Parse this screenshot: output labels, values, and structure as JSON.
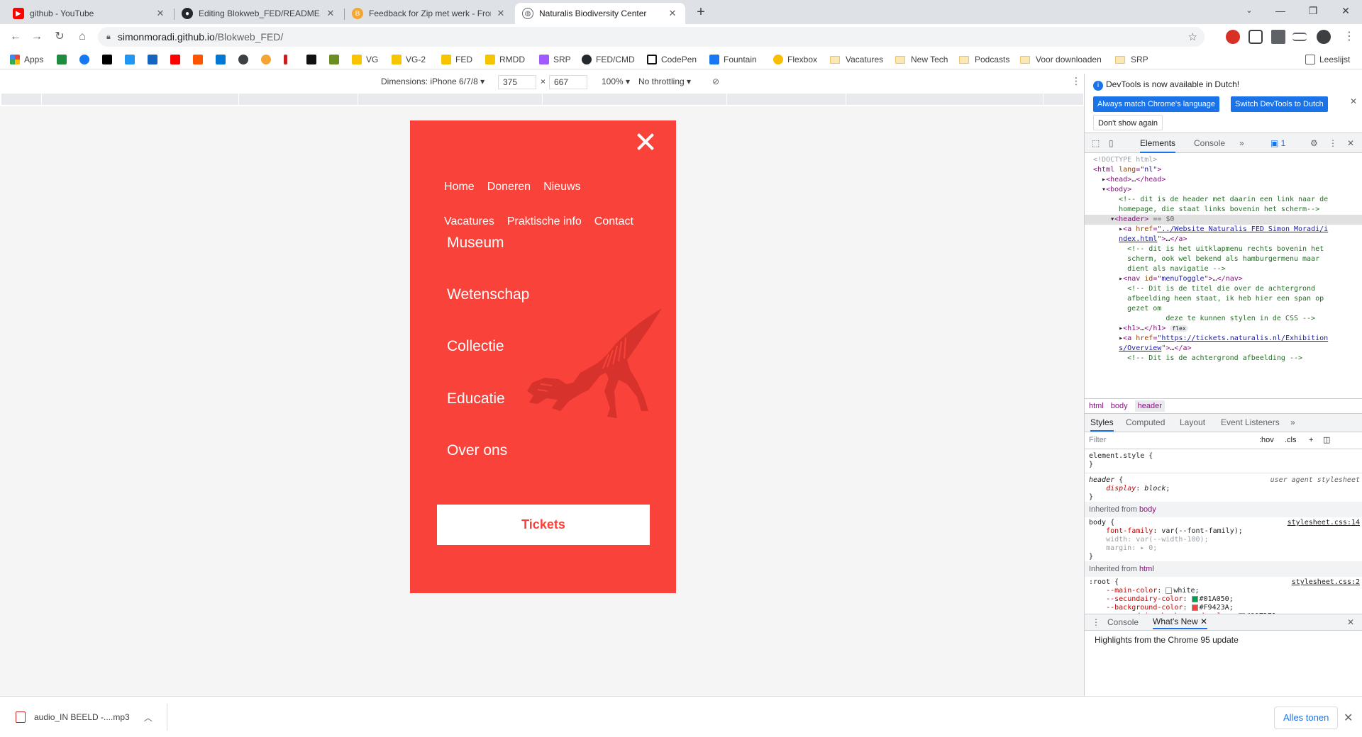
{
  "tabs": [
    {
      "title": "github - YouTube",
      "icon": "youtube-icon",
      "color": "#ff0000"
    },
    {
      "title": "Editing Blokweb_FED/README.m",
      "icon": "github-icon",
      "color": "#24292e"
    },
    {
      "title": "Feedback for Zip met werk - Fror",
      "icon": "feedback-icon",
      "color": "#f4a533"
    },
    {
      "title": "Naturalis Biodiversity Center",
      "icon": "globe-icon",
      "color": "#5f6368"
    }
  ],
  "omnibox": {
    "host": "simonmoradi.github.io",
    "path": "/Blokweb_FED/"
  },
  "bookmarks": {
    "apps": "Apps",
    "items": [
      "VG",
      "VG-2",
      "FED",
      "RMDD",
      "SRP",
      "FED/CMD",
      "CodePen",
      "Fountain",
      "Flexbox"
    ],
    "folders": [
      "Vacatures",
      "New Tech",
      "Podcasts",
      "Voor downloaden",
      "SRP"
    ],
    "reading_list": "Leeslijst"
  },
  "device_toolbar": {
    "dimensions": "Dimensions: iPhone 6/7/8 ▾",
    "width": "375",
    "height": "667",
    "times": "×",
    "zoom": "100% ▾",
    "throttling": "No throttling ▾"
  },
  "page": {
    "subnav_row1": [
      "Home",
      "Doneren",
      "Nieuws"
    ],
    "subnav_row2": [
      "Vacatures",
      "Praktische info",
      "Contact"
    ],
    "mainnav": [
      "Museum",
      "Wetenschap",
      "Collectie",
      "Educatie",
      "Over ons"
    ],
    "tickets": "Tickets",
    "bg_color": "#f9423a"
  },
  "devtools": {
    "info_msg": "DevTools is now available in Dutch!",
    "btn_match": "Always match Chrome's language",
    "btn_switch": "Switch DevTools to Dutch",
    "btn_dont": "Don't show again",
    "tab_elements": "Elements",
    "tab_console": "Console",
    "issues_count": "1",
    "crumbs": [
      "html",
      "body",
      "header"
    ],
    "subtabs": [
      "Styles",
      "Computed",
      "Layout",
      "Event Listeners"
    ],
    "filter_placeholder": "Filter",
    "filter_hov": ":hov",
    "filter_cls": ".cls",
    "inherited_body": "Inherited from",
    "inherited_body_tag": "body",
    "inherited_html": "Inherited from",
    "inherited_html_tag": "html",
    "drawer_console": "Console",
    "drawer_whatsnew": "What's New",
    "drawer_text": "Highlights from the Chrome 95 update"
  },
  "download": {
    "file": "audio_IN BEELD -....mp3",
    "show_all": "Alles tonen"
  }
}
